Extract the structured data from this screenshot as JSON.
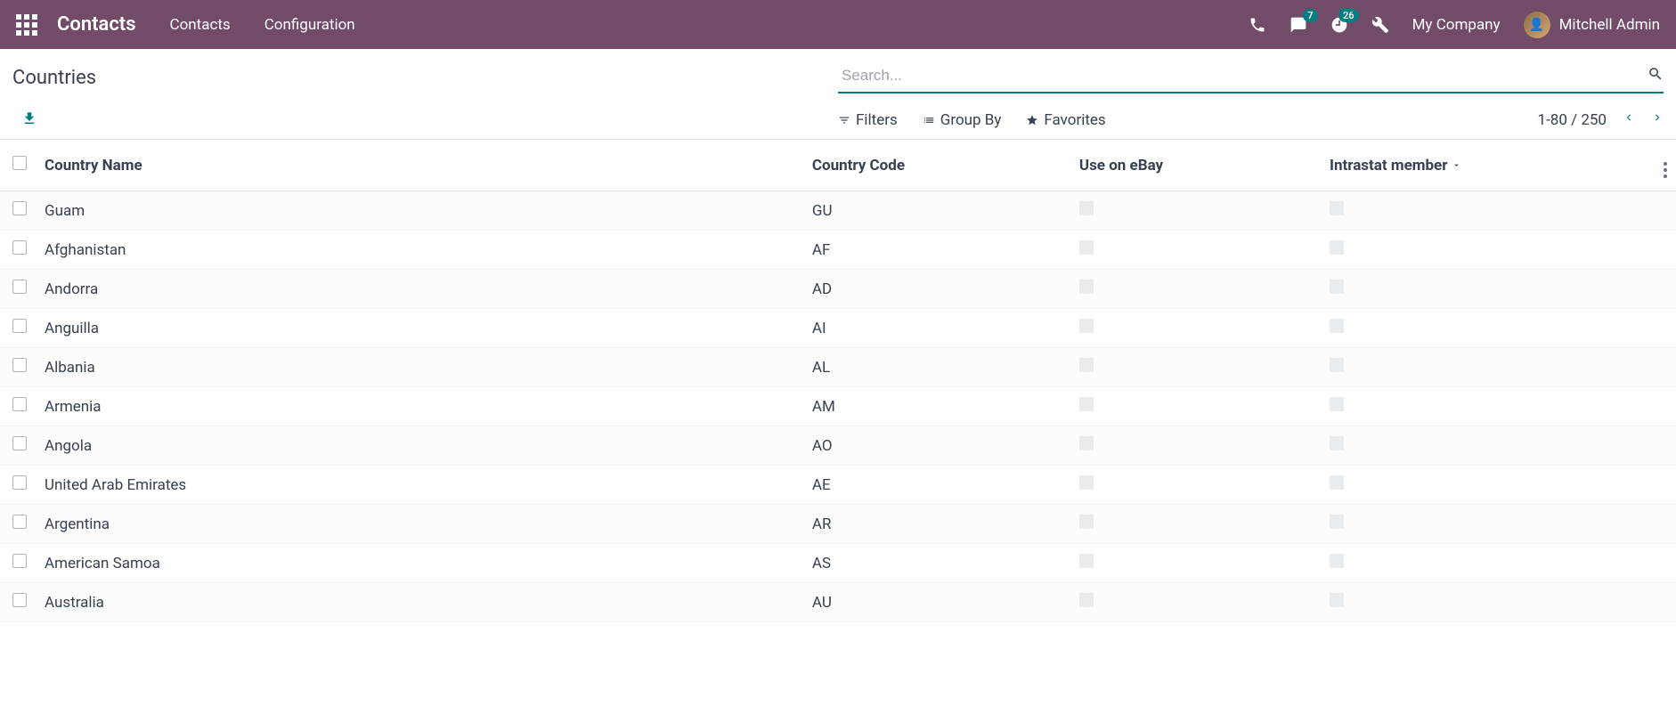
{
  "navbar": {
    "brand": "Contacts",
    "menu": [
      "Contacts",
      "Configuration"
    ],
    "messages_badge": "7",
    "activities_badge": "26",
    "company": "My Company",
    "user": "Mitchell Admin"
  },
  "breadcrumb": "Countries",
  "search": {
    "placeholder": "Search..."
  },
  "toolbar": {
    "filters": "Filters",
    "groupby": "Group By",
    "favorites": "Favorites"
  },
  "pager": {
    "range": "1-80 / 250"
  },
  "columns": {
    "name": "Country Name",
    "code": "Country Code",
    "ebay": "Use on eBay",
    "intrastat": "Intrastat member"
  },
  "rows": [
    {
      "name": "Guam",
      "code": "GU"
    },
    {
      "name": "Afghanistan",
      "code": "AF"
    },
    {
      "name": "Andorra",
      "code": "AD"
    },
    {
      "name": "Anguilla",
      "code": "AI"
    },
    {
      "name": "Albania",
      "code": "AL"
    },
    {
      "name": "Armenia",
      "code": "AM"
    },
    {
      "name": "Angola",
      "code": "AO"
    },
    {
      "name": "United Arab Emirates",
      "code": "AE"
    },
    {
      "name": "Argentina",
      "code": "AR"
    },
    {
      "name": "American Samoa",
      "code": "AS"
    },
    {
      "name": "Australia",
      "code": "AU"
    }
  ]
}
